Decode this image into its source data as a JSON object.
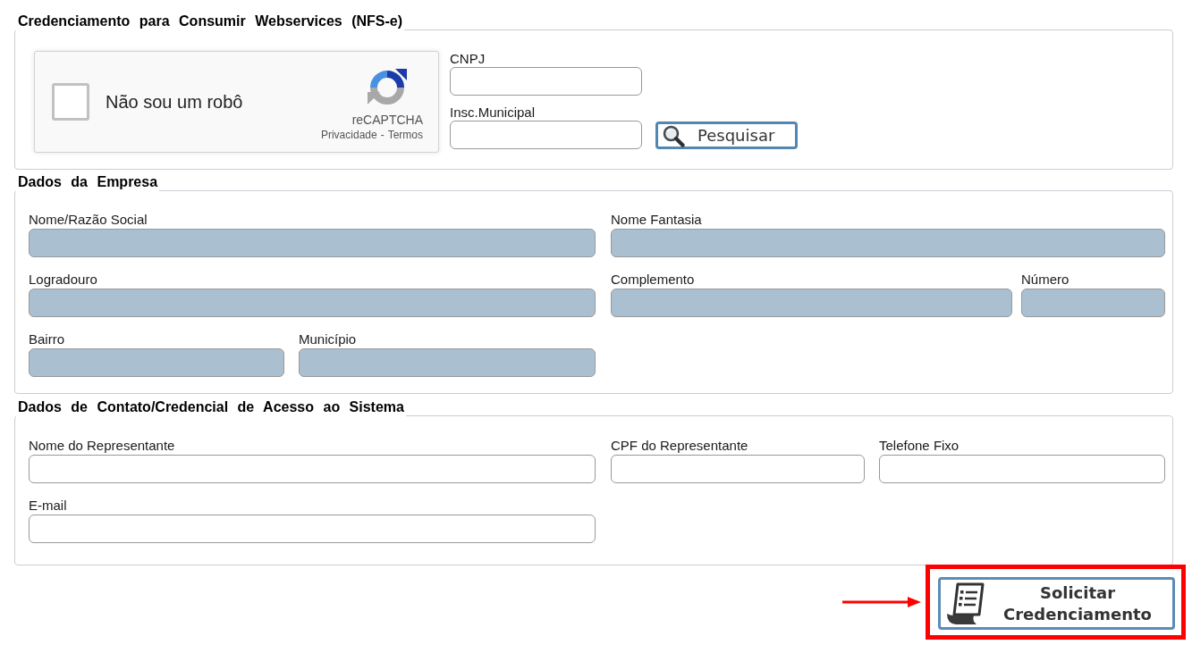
{
  "credentials": {
    "legend": "Credenciamento para Consumir Webservices (NFS-e)",
    "captcha": {
      "label": "Não sou um robô",
      "checked": false,
      "brand": "reCAPTCHA",
      "links": [
        "Privacidade",
        "Termos"
      ],
      "separator": "-"
    },
    "fields": [
      {
        "label": "CNPJ",
        "disabled": false
      },
      {
        "label": "Insc.Municipal",
        "disabled": false
      }
    ],
    "search_button": "Pesquisar"
  },
  "company": {
    "legend": "Dados da Empresa",
    "rows": [
      [
        {
          "label": "Nome/Razão Social",
          "disabled": true
        },
        {
          "label": "Nome Fantasia",
          "disabled": true
        }
      ],
      [
        {
          "label": "Logradouro",
          "disabled": true
        },
        {
          "label": "Complemento",
          "disabled": true
        },
        {
          "label": "Número",
          "disabled": true
        }
      ],
      [
        {
          "label": "Bairro",
          "disabled": true
        },
        {
          "label": "Município",
          "disabled": true
        }
      ]
    ]
  },
  "contact": {
    "legend": "Dados de Contato/Credencial de Acesso ao Sistema",
    "rows": [
      [
        {
          "label": "Nome do Representante",
          "disabled": false
        },
        {
          "label": "CPF do Representante",
          "disabled": false
        },
        {
          "label": "Telefone Fixo",
          "disabled": false
        }
      ],
      [
        {
          "label": "E-mail",
          "disabled": false
        }
      ]
    ]
  },
  "submit_button": {
    "label": "Solicitar Credenciamento",
    "highlighted": true
  }
}
